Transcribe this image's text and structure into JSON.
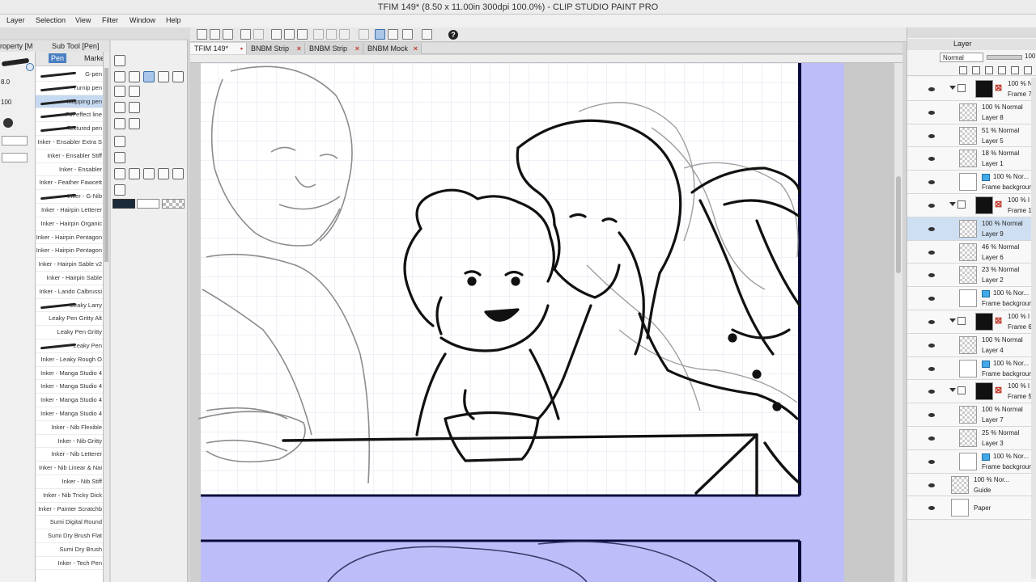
{
  "window": {
    "title": "TFIM 149* (8.50 x 11.00in 300dpi 100.0%)  - CLIP STUDIO PAINT PRO"
  },
  "menu": [
    "Layer",
    "Selection",
    "View",
    "Filter",
    "Window",
    "Help"
  ],
  "left_panels": {
    "property_tab": "roperty [M",
    "subtool_tab": "Sub Tool [Pen]",
    "brush_size": "8.0",
    "opacity": "100",
    "subtool_tabs": [
      "Pen",
      "Marker"
    ],
    "brushes": [
      "G-pen",
      "Turnip pen",
      "Mapping pen",
      "For effect line",
      "Textured pen",
      "Inker - Ensabler Extra S",
      "Inker - Ensabler Stiff",
      "Inker - Ensabler",
      "Inker - Feather Fawcett",
      "Inker - G-Nib",
      "Inker - Hairpin Letterer",
      "Inker - Hairpin Organic",
      "Inker - Hairpin Pentagon",
      "Inker - Hairpin Pentagon",
      "Inker - Hairpin Sable v2",
      "Inker - Hairpin Sable",
      "Inker - Lando Calbrussi",
      "Leaky Larry",
      "Leaky Pen Gritty Alt",
      "Leaky Pen Gritty",
      "Leaky Pen",
      "Inker - Leaky Rough O",
      "Inker - Manga Studio 4",
      "Inker - Manga Studio 4",
      "Inker - Manga Studio 4",
      "Inker - Manga Studio 4",
      "Inker - Nib Flexible",
      "Inker - Nib Gritty",
      "Inker - Nib Letterer",
      "Inker - Nib Linear & Nai",
      "Inker - Nib Stiff",
      "Inker - Nib Tricky Dick",
      "Inker - Painter Scratchb",
      "Sumi Digital Round",
      "Sumi Dry Brush Flat",
      "Sumi Dry Brush",
      "Inker - Tech Pen"
    ],
    "selected_brush_index": 2
  },
  "document_tabs": [
    {
      "label": "TFIM 149*",
      "active": true
    },
    {
      "label": "BNBM Strip",
      "active": false
    },
    {
      "label": "BNBM Strip",
      "active": false
    },
    {
      "label": "BNBM Mock",
      "active": false
    }
  ],
  "layer_panel": {
    "tab": "Layer",
    "blend_mode": "Normal",
    "opacity": "100",
    "layers": [
      {
        "pct": "100 %",
        "mode": "N",
        "name": "Frame 7",
        "kind": "folder",
        "depth": 0
      },
      {
        "pct": "100 %",
        "mode": "Normal",
        "name": "Layer 8",
        "kind": "raster",
        "depth": 1
      },
      {
        "pct": "51 %",
        "mode": "Normal",
        "name": "Layer 5",
        "kind": "raster",
        "depth": 1
      },
      {
        "pct": "18 %",
        "mode": "Normal",
        "name": "Layer 1",
        "kind": "raster",
        "depth": 1
      },
      {
        "pct": "100 %",
        "mode": "Nor...",
        "name": "Frame background",
        "kind": "paper",
        "depth": 1
      },
      {
        "pct": "100 %",
        "mode": "I",
        "name": "Frame 1",
        "kind": "folder",
        "depth": 0
      },
      {
        "pct": "100 %",
        "mode": "Normal",
        "name": "Layer 9",
        "kind": "raster",
        "depth": 1,
        "selected": true
      },
      {
        "pct": "46 %",
        "mode": "Normal",
        "name": "Layer 6",
        "kind": "raster",
        "depth": 1
      },
      {
        "pct": "23 %",
        "mode": "Normal",
        "name": "Layer 2",
        "kind": "raster",
        "depth": 1
      },
      {
        "pct": "100 %",
        "mode": "Nor...",
        "name": "Frame background",
        "kind": "paper",
        "depth": 1
      },
      {
        "pct": "100 %",
        "mode": "I",
        "name": "Frame 6",
        "kind": "folder",
        "depth": 0
      },
      {
        "pct": "100 %",
        "mode": "Normal",
        "name": "Layer 4",
        "kind": "raster",
        "depth": 1
      },
      {
        "pct": "100 %",
        "mode": "Nor...",
        "name": "Frame background",
        "kind": "paper",
        "depth": 1
      },
      {
        "pct": "100 %",
        "mode": "I",
        "name": "Frame 5",
        "kind": "folder",
        "depth": 0
      },
      {
        "pct": "100 %",
        "mode": "Normal",
        "name": "Layer 7",
        "kind": "raster",
        "depth": 1
      },
      {
        "pct": "25 %",
        "mode": "Normal",
        "name": "Layer 3",
        "kind": "raster",
        "depth": 1
      },
      {
        "pct": "100 %",
        "mode": "Nor...",
        "name": "Frame background",
        "kind": "paper",
        "depth": 1
      },
      {
        "pct": "100 %",
        "mode": "Nor...",
        "name": "Guide",
        "kind": "guide",
        "depth": 0
      },
      {
        "pct": "",
        "mode": "",
        "name": "Paper",
        "kind": "paper-base",
        "depth": 0
      }
    ]
  },
  "icons": {
    "help": "?",
    "help_icon": "help-icon"
  },
  "colors": {
    "accent": "#4a7fc0",
    "gutter": "#bdbdf9",
    "panel_border": "#0a0a3a"
  }
}
